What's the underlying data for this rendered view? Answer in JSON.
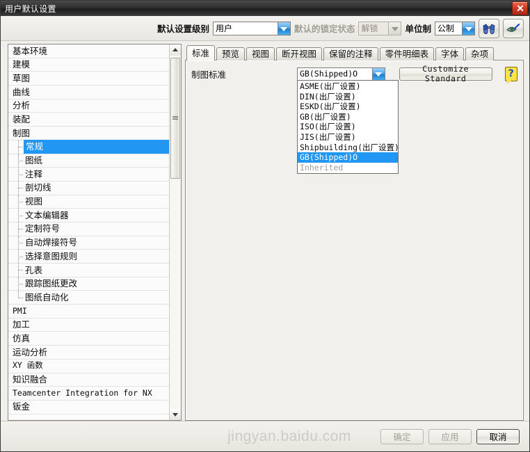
{
  "window": {
    "title": "用户默认设置",
    "close_label": "×"
  },
  "toolbar": {
    "level_label": "默认设置级别",
    "level_value": "用户",
    "lock_label": "默认的锁定状态",
    "lock_value": "解锁",
    "units_label": "单位制",
    "units_value": "公制",
    "find_button_name": "查找",
    "view_button_name": "管理当前设置"
  },
  "tree": {
    "items": [
      {
        "label": "基本环境",
        "level": 0
      },
      {
        "label": "建模",
        "level": 0
      },
      {
        "label": "草图",
        "level": 0
      },
      {
        "label": "曲线",
        "level": 0
      },
      {
        "label": "分析",
        "level": 0
      },
      {
        "label": "装配",
        "level": 0
      },
      {
        "label": "制图",
        "level": 0
      },
      {
        "label": "常规",
        "level": 1,
        "selected": true
      },
      {
        "label": "图纸",
        "level": 1
      },
      {
        "label": "注释",
        "level": 1
      },
      {
        "label": "剖切线",
        "level": 1
      },
      {
        "label": "视图",
        "level": 1
      },
      {
        "label": "文本编辑器",
        "level": 1
      },
      {
        "label": "定制符号",
        "level": 1
      },
      {
        "label": "自动焊接符号",
        "level": 1
      },
      {
        "label": "选择意图规则",
        "level": 1
      },
      {
        "label": "孔表",
        "level": 1
      },
      {
        "label": "跟踪图纸更改",
        "level": 1
      },
      {
        "label": "图纸自动化",
        "level": 1,
        "last": true
      },
      {
        "label": "PMI",
        "level": 0,
        "mono": true
      },
      {
        "label": "加工",
        "level": 0
      },
      {
        "label": "仿真",
        "level": 0
      },
      {
        "label": "运动分析",
        "level": 0
      },
      {
        "label": "XY 函数",
        "level": 0,
        "mono": true
      },
      {
        "label": "知识融合",
        "level": 0
      },
      {
        "label": "Teamcenter Integration for NX",
        "level": 0,
        "mono": true
      },
      {
        "label": "钣金",
        "level": 0
      }
    ]
  },
  "tabs": [
    {
      "label": "标准",
      "active": true
    },
    {
      "label": "预览",
      "active": false
    },
    {
      "label": "视图",
      "active": false
    },
    {
      "label": "断开视图",
      "active": false
    },
    {
      "label": "保留的注释",
      "active": false
    },
    {
      "label": "零件明细表",
      "active": false
    },
    {
      "label": "字体",
      "active": false
    },
    {
      "label": "杂项",
      "active": false
    }
  ],
  "content": {
    "standard_label": "制图标准",
    "standard_value": "GB(Shipped)O",
    "customize_button": "Customize Standard",
    "help_glyph": "?",
    "dropdown_options": [
      {
        "label": "ASME(出厂设置)",
        "state": "normal"
      },
      {
        "label": "DIN(出厂设置)",
        "state": "normal"
      },
      {
        "label": "ESKD(出厂设置)",
        "state": "normal"
      },
      {
        "label": "GB(出厂设置)",
        "state": "normal"
      },
      {
        "label": "ISO(出厂设置)",
        "state": "normal"
      },
      {
        "label": "JIS(出厂设置)",
        "state": "normal"
      },
      {
        "label": "Shipbuilding(出厂设置)",
        "state": "normal"
      },
      {
        "label": "GB(Shipped)O",
        "state": "selected"
      },
      {
        "label": "Inherited",
        "state": "disabled"
      }
    ]
  },
  "footer": {
    "ok_label": "确定",
    "apply_label": "应用",
    "cancel_label": "取消"
  },
  "watermark": {
    "text": "jingyan.baidu.com"
  },
  "colors": {
    "selection_blue": "#2196f3",
    "close_red": "#cf3a21",
    "help_yellow": "#ffe24a"
  }
}
